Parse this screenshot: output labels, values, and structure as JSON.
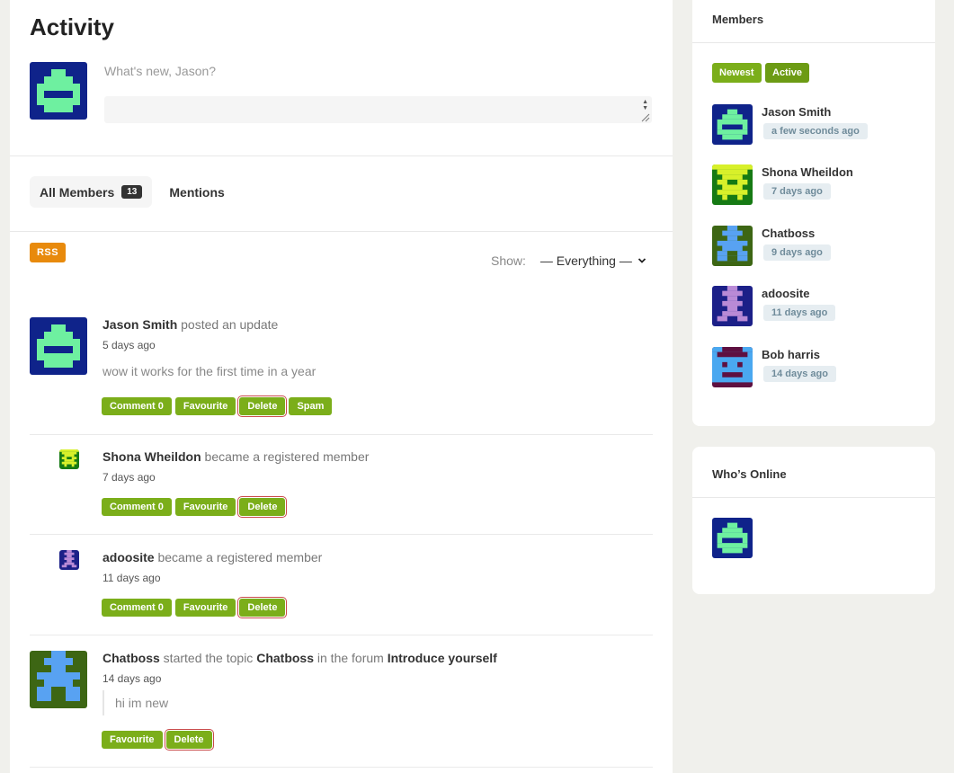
{
  "activity": {
    "title": "Activity",
    "whats_new": "What's new, Jason?",
    "tabs": [
      {
        "label": "All Members",
        "count": "13"
      },
      {
        "label": "Mentions"
      }
    ],
    "rss_label": "RSS",
    "show_label": "Show:",
    "show_value": "— Everything —",
    "items": [
      {
        "user": "Jason Smith",
        "action": " posted an update",
        "time": "5 days ago",
        "content": "wow it works for the first time in a year",
        "buttons": [
          "Comment 0",
          "Favourite",
          "Delete",
          "Spam"
        ]
      },
      {
        "user": "Shona Wheildon",
        "action": " became a registered member",
        "time": "7 days ago",
        "buttons": [
          "Comment 0",
          "Favourite",
          "Delete"
        ]
      },
      {
        "user": "adoosite",
        "action": " became a registered member",
        "time": "11 days ago",
        "buttons": [
          "Comment 0",
          "Favourite",
          "Delete"
        ]
      },
      {
        "user": "Chatboss",
        "action_a": " started the topic ",
        "topic": "Chatboss",
        "action_b": " in the forum ",
        "forum": "Introduce yourself",
        "time": "14 days ago",
        "content": "hi im new",
        "buttons": [
          "Favourite",
          "Delete"
        ]
      }
    ]
  },
  "members_widget": {
    "title": "Members",
    "filters": [
      "Newest",
      "Active"
    ],
    "members": [
      {
        "name": "Jason Smith",
        "time": "a few seconds ago"
      },
      {
        "name": "Shona Wheildon",
        "time": "7 days ago"
      },
      {
        "name": "Chatboss",
        "time": "9 days ago"
      },
      {
        "name": "adoosite",
        "time": "11 days ago"
      },
      {
        "name": "Bob harris",
        "time": "14 days ago"
      }
    ]
  },
  "online_widget": {
    "title": "Who’s Online"
  },
  "colors": {
    "accent_green": "#7bae1a",
    "rss_orange": "#e88a0c",
    "time_badge_bg": "#e6edf1",
    "time_badge_text": "#6f8b9a"
  }
}
